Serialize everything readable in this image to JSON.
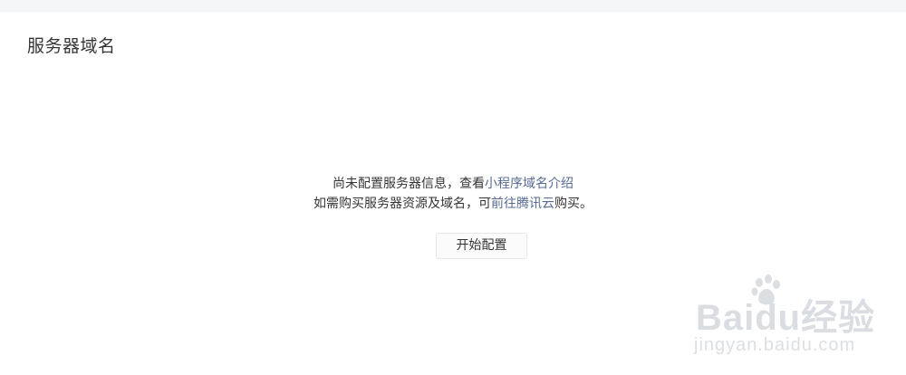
{
  "section": {
    "title": "服务器域名"
  },
  "empty_state": {
    "line1_prefix": "尚未配置服务器信息，查看",
    "line1_link": "小程序域名介绍",
    "line2_prefix": "如需购买服务器资源及域名，可",
    "line2_link": "前往腾讯云",
    "line2_suffix": "购买。"
  },
  "actions": {
    "start_label": "开始配置"
  },
  "watermark": {
    "logo_text": "Baidu经验",
    "url": "jingyan.baidu.com"
  },
  "colors": {
    "link": "#576b95",
    "text": "#353535",
    "top_strip": "#f5f6f8"
  }
}
